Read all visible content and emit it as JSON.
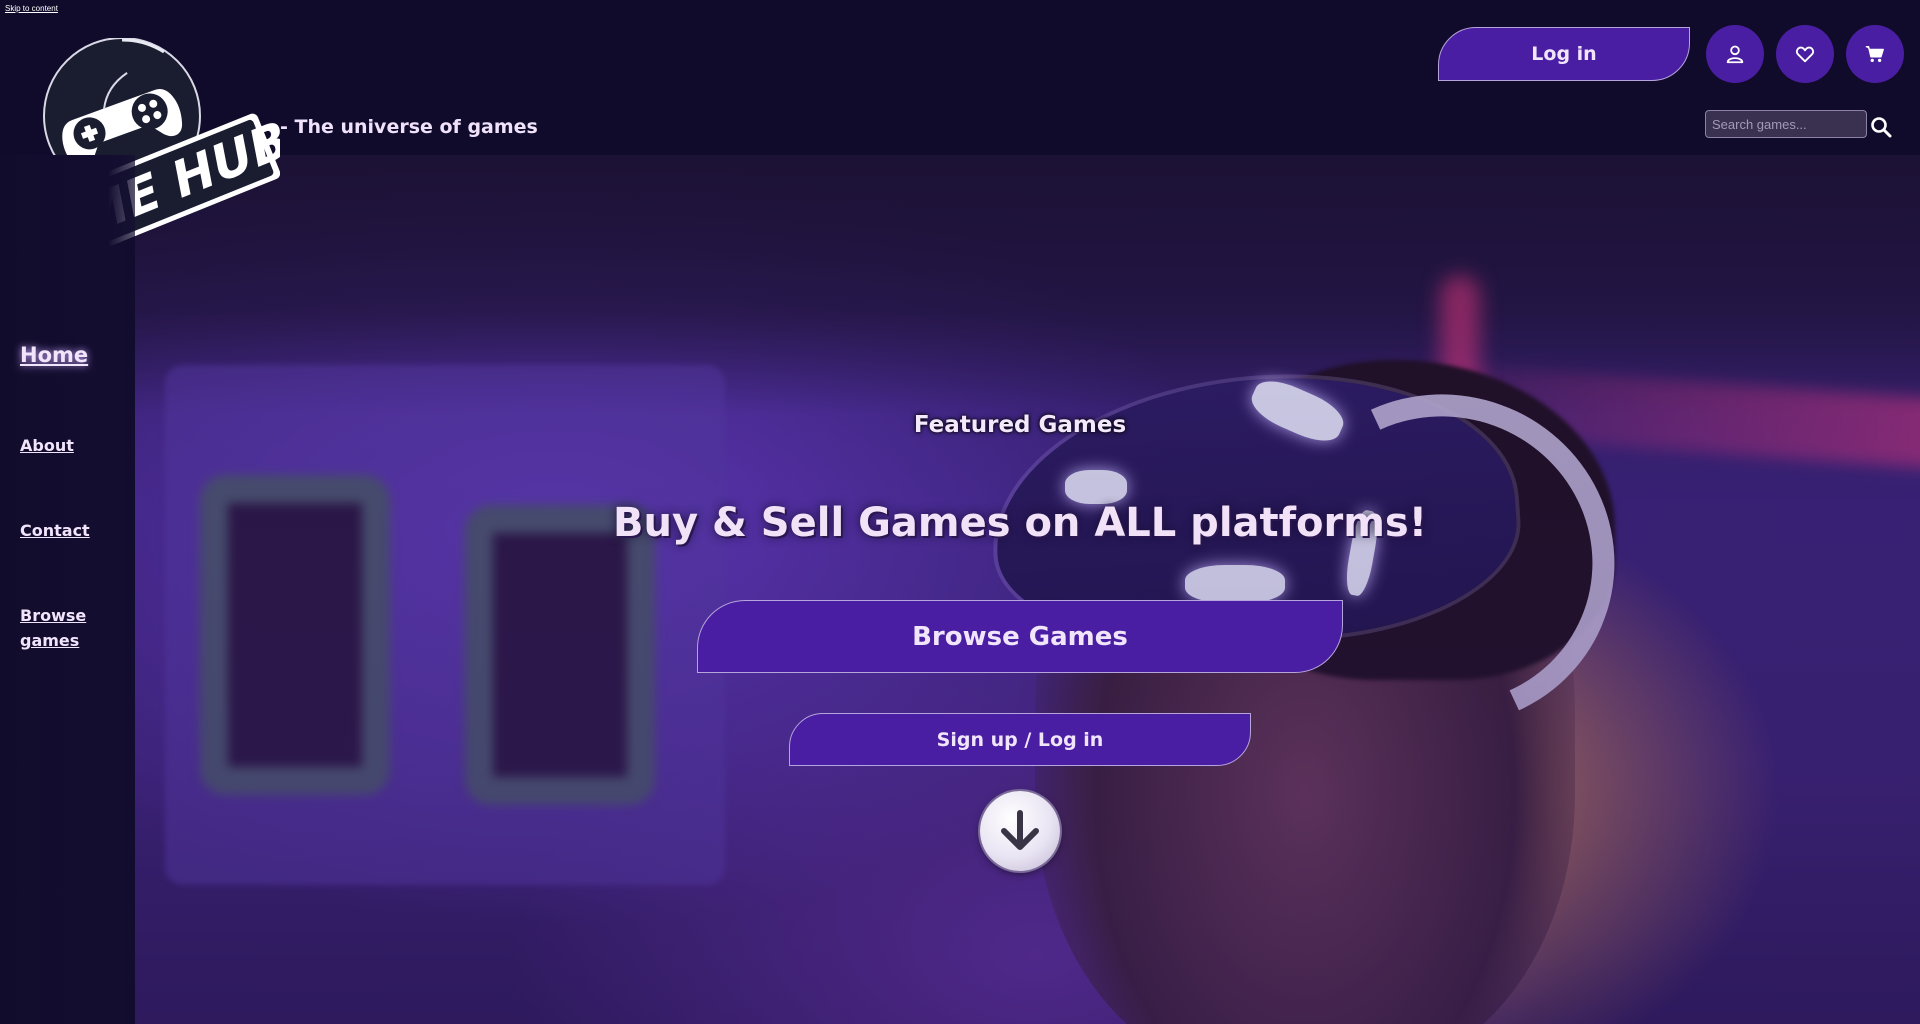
{
  "skip_link": "Skip to content",
  "brand": {
    "logo_text": "GAME HUB",
    "tagline": "- The universe of games"
  },
  "header": {
    "login_label": "Log in",
    "icons": [
      "user-icon",
      "heart-icon",
      "cart-icon"
    ],
    "search_placeholder": "Search games..."
  },
  "sidebar": {
    "items": [
      {
        "label": "Home",
        "active": true
      },
      {
        "label": "About"
      },
      {
        "label": "Contact"
      },
      {
        "label": "Browse games"
      }
    ]
  },
  "hero": {
    "heading": "Featured Games",
    "title": "Buy & Sell Games on ALL platforms!",
    "browse_label": "Browse Games",
    "signup_label": "Sign up / Log in",
    "scroll_icon": "arrow-down-icon"
  },
  "colors": {
    "page_bg": "#110b2b",
    "button_purple": "#4a1ea3",
    "text_light": "#f1e5fb"
  }
}
